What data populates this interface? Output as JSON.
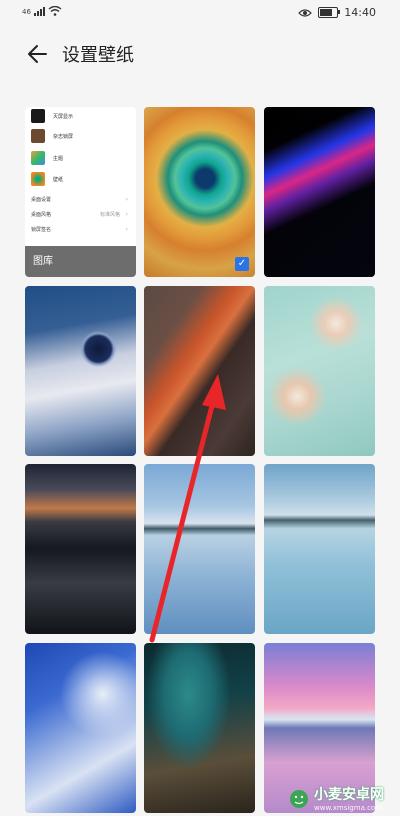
{
  "status": {
    "signal": "46",
    "time": "14:40"
  },
  "header": {
    "title": "设置壁纸"
  },
  "gallery": {
    "items": [
      {
        "label": "灭屏显示"
      },
      {
        "label": "杂志锁屏"
      },
      {
        "label": "主题"
      },
      {
        "label": "壁纸"
      }
    ],
    "settings": [
      {
        "label": "桌面设置",
        "value": ""
      },
      {
        "label": "桌面风格",
        "value": "标准风格"
      },
      {
        "label": "锁屏签名",
        "value": ""
      }
    ],
    "footer_label": "图库"
  },
  "wallpapers": [
    {
      "name": "wallpaper-swirl-teal",
      "selected": true
    },
    {
      "name": "wallpaper-neon-streaks",
      "selected": false
    },
    {
      "name": "wallpaper-silver-orb",
      "selected": false
    },
    {
      "name": "wallpaper-red-terrain",
      "selected": false
    },
    {
      "name": "wallpaper-jade-marble",
      "selected": false
    },
    {
      "name": "wallpaper-mountain-sunset",
      "selected": false
    },
    {
      "name": "wallpaper-lake-town",
      "selected": false
    },
    {
      "name": "wallpaper-lake-bridge",
      "selected": false
    },
    {
      "name": "wallpaper-blue-ink",
      "selected": false
    },
    {
      "name": "wallpaper-green-wave",
      "selected": false
    },
    {
      "name": "wallpaper-pink-glacier",
      "selected": false
    }
  ],
  "watermark": {
    "text": "小麦安卓网",
    "url": "www.xmsigma.com"
  },
  "colors": {
    "accent": "#2a73e8",
    "arrow": "#e8262a"
  }
}
